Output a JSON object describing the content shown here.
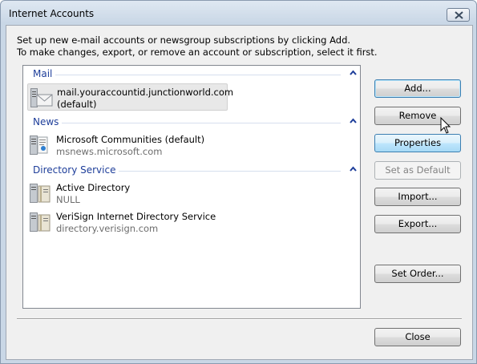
{
  "window": {
    "title": "Internet Accounts"
  },
  "intro": {
    "line1": "Set up new e-mail accounts or newsgroup subscriptions by clicking Add.",
    "line2": "To make changes, export, or remove an account or subscription, select it first."
  },
  "groups": [
    {
      "name": "Mail",
      "entries": [
        {
          "name": "mail.youraccountid.junctionworld.com",
          "sub": "(default)",
          "icon": "mail-server-icon",
          "selected": true
        }
      ]
    },
    {
      "name": "News",
      "entries": [
        {
          "name": "Microsoft Communities (default)",
          "sub": "msnews.microsoft.com",
          "icon": "news-server-icon"
        }
      ]
    },
    {
      "name": "Directory Service",
      "entries": [
        {
          "name": "Active Directory",
          "sub": "NULL",
          "icon": "directory-server-icon"
        },
        {
          "name": "VeriSign Internet Directory Service",
          "sub": "directory.verisign.com",
          "icon": "directory-server-icon"
        }
      ]
    }
  ],
  "buttons": {
    "add": "Add...",
    "remove": "Remove",
    "properties": "Properties",
    "set_default": "Set as Default",
    "import": "Import...",
    "export": "Export...",
    "set_order": "Set Order...",
    "close": "Close"
  },
  "colors": {
    "group_header": "#1e3e9a",
    "hover_accent": "#3c7fb1"
  }
}
